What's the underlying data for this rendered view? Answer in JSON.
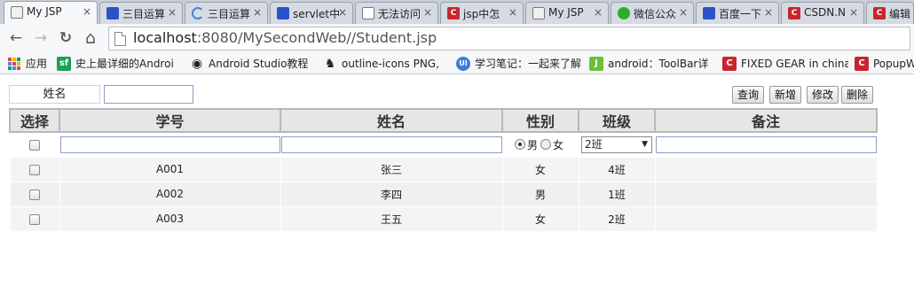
{
  "browser": {
    "tabs": [
      {
        "title": "My JSP",
        "icon": "jsp-page-icon",
        "active": true
      },
      {
        "title": "三目运算",
        "icon": "baidu-paw-icon"
      },
      {
        "title": "三目运算",
        "icon": "loading-spinner-icon"
      },
      {
        "title": "servlet中",
        "icon": "baidu-paw-icon"
      },
      {
        "title": "无法访问",
        "icon": "document-icon"
      },
      {
        "title": "jsp中怎",
        "icon": "csdn-icon"
      },
      {
        "title": "My JSP",
        "icon": "jsp-page-icon"
      },
      {
        "title": "微信公众",
        "icon": "wechat-icon"
      },
      {
        "title": "百度一下",
        "icon": "baidu-paw-icon"
      },
      {
        "title": "CSDN.N",
        "icon": "csdn-icon"
      },
      {
        "title": "编辑",
        "icon": "csdn-icon"
      }
    ],
    "close_glyph": "×",
    "nav": {
      "back": "←",
      "forward": "→",
      "reload": "↻",
      "home": "⌂"
    },
    "url": {
      "host": "localhost",
      "rest": ":8080/MySecondWeb//Student.jsp"
    },
    "bookmarks": [
      {
        "label": "应用",
        "icon": "apps-grid-icon"
      },
      {
        "label": "史上最详细的Androi",
        "icon": "sf-icon",
        "icon_text": "sf"
      },
      {
        "label": "Android Studio教程",
        "icon": "github-icon"
      },
      {
        "label": "outline-icons PNG,",
        "icon": "person-icon"
      },
      {
        "label": "学习笔记：一起来了解",
        "icon": "ui-icon",
        "icon_text": "UI"
      },
      {
        "label": "android：ToolBar详",
        "icon": "j-icon",
        "icon_text": "J"
      },
      {
        "label": "FIXED GEAR in china",
        "icon": "csdn-icon",
        "icon_text": "C"
      },
      {
        "label": "PopupW",
        "icon": "csdn-icon",
        "icon_text": "C"
      }
    ]
  },
  "search": {
    "label": "姓名",
    "value": ""
  },
  "actions": {
    "query": "查询",
    "add": "新增",
    "edit": "修改",
    "delete": "删除"
  },
  "table": {
    "headers": {
      "select": "选择",
      "id": "学号",
      "name": "姓名",
      "gender": "性别",
      "class": "班级",
      "remark": "备注"
    },
    "input_row": {
      "male": "男",
      "female": "女",
      "gender_selected": "男",
      "class_value": "2班",
      "class_arrow": "▼"
    },
    "rows": [
      {
        "id": "A001",
        "name": "张三",
        "gender": "女",
        "class": "4班",
        "remark": ""
      },
      {
        "id": "A002",
        "name": "李四",
        "gender": "男",
        "class": "1班",
        "remark": ""
      },
      {
        "id": "A003",
        "name": "王五",
        "gender": "女",
        "class": "2班",
        "remark": ""
      }
    ]
  },
  "colors": {
    "tab_bg": "#d6dbe3",
    "active_tab": "#f6f7f8",
    "header_bg": "#e6e6e6",
    "row_bg": "#f0f0f0",
    "input_border": "#8aa0c8"
  }
}
